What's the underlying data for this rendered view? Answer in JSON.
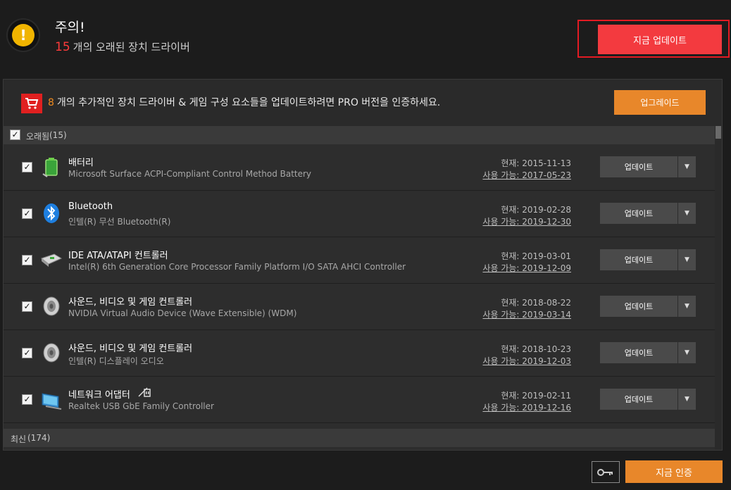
{
  "header": {
    "title": "주의!",
    "outdated_count": "15",
    "outdated_text": "개의 오래된 장치 드라이버",
    "update_all_label": "지금 업데이트"
  },
  "promo": {
    "count": "8",
    "text": "개의 추가적인 장치 드라이버 & 게임 구성 요소들을 업데이트하려면 PRO 버전을 인증하세요.",
    "upgrade_label": "업그레이드"
  },
  "groups": {
    "outdated": {
      "label": "오래됨",
      "count": "(15)"
    },
    "current": {
      "label": "최신",
      "count": "(174)"
    }
  },
  "rows": [
    {
      "name": "배터리",
      "desc": "Microsoft Surface ACPI-Compliant Control Method Battery",
      "current": "현재: 2015-11-13",
      "available": "사용 가능: 2017-05-23",
      "button": "업데이트",
      "icon": "battery-icon"
    },
    {
      "name": "Bluetooth",
      "desc": "인텔(R) 무선 Bluetooth(R)",
      "current": "현재: 2019-02-28",
      "available": "사용 가능: 2019-12-30",
      "button": "업데이트",
      "icon": "bluetooth-icon"
    },
    {
      "name": "IDE ATA/ATAPI 컨트롤러",
      "desc": "Intel(R) 6th Generation Core Processor Family Platform I/O SATA AHCI Controller",
      "current": "현재: 2019-03-01",
      "available": "사용 가능: 2019-12-09",
      "button": "업데이트",
      "icon": "controller-card-icon"
    },
    {
      "name": "사운드, 비디오 및 게임 컨트롤러",
      "desc": "NVIDIA Virtual Audio Device (Wave Extensible) (WDM)",
      "current": "현재: 2018-08-22",
      "available": "사용 가능: 2019-03-14",
      "button": "업데이트",
      "icon": "speaker-icon"
    },
    {
      "name": "사운드, 비디오 및 게임 컨트롤러",
      "desc": "인텔(R) 디스플레이 오디오",
      "current": "현재: 2018-10-23",
      "available": "사용 가능: 2019-12-03",
      "button": "업데이트",
      "icon": "speaker-icon"
    },
    {
      "name": "네트워크 어댑터",
      "desc": "Realtek USB GbE Family Controller",
      "current": "현재: 2019-02-11",
      "available": "사용 가능: 2019-12-16",
      "button": "업데이트",
      "icon": "network-adapter-icon"
    }
  ],
  "footer": {
    "activate_label": "지금 인증"
  },
  "colors": {
    "accent_red": "#f33a3f",
    "accent_orange": "#e8872a",
    "warning_yellow": "#f0b400"
  }
}
